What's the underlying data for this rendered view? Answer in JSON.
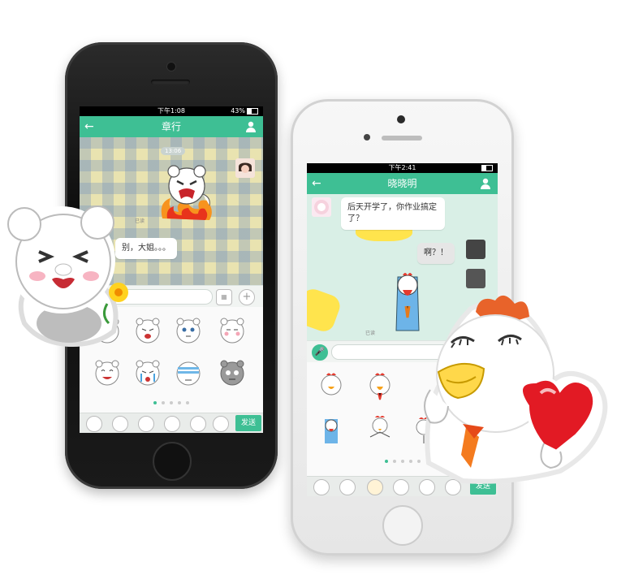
{
  "left_phone": {
    "status": {
      "time": "下午1:08",
      "battery": "43%"
    },
    "title": "章行",
    "timestamp": "13:06",
    "read_label": "已读",
    "message": "别，大姐。。。",
    "send_label": "发送"
  },
  "right_phone": {
    "status": {
      "time": "下午2:41"
    },
    "title": "晓晓明",
    "message_in": "后天开学了，你作业搞定了？",
    "message_out": "啊？！",
    "read_label": "已读",
    "send_label": "发送"
  },
  "colors": {
    "accent": "#3ebf94",
    "rooster_red": "#e53a2e",
    "heart_red": "#e21a24"
  }
}
